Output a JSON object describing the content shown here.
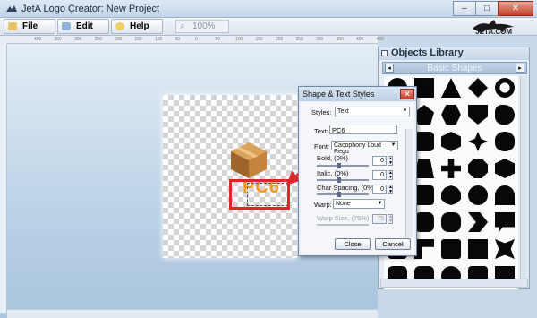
{
  "window": {
    "title": "JetA Logo Creator: New Project",
    "buttons": {
      "minimize": "–",
      "maximize": "□",
      "close": "✕"
    }
  },
  "toolbar": {
    "file_label": "File",
    "edit_label": "Edit",
    "help_label": "Help",
    "zoom_value": "100%"
  },
  "brand": {
    "logo_text": "JETA.COM"
  },
  "ruler": {
    "ticks": [
      "400",
      "350",
      "300",
      "250",
      "200",
      "150",
      "100",
      "50",
      "0",
      "50",
      "100",
      "150",
      "200",
      "250",
      "300",
      "350",
      "400",
      "450"
    ]
  },
  "canvas": {
    "logo_text": "PC6"
  },
  "library": {
    "title": "Objects Library",
    "category": "Basic Shapes",
    "prev_icon": "◂",
    "next_icon": "▸"
  },
  "dialog": {
    "title": "Shape & Text Styles",
    "close_icon": "✕",
    "styles_label": "Styles:",
    "styles_value": "Text",
    "text_label": "Text:",
    "text_value": "PC6",
    "font_label": "Font:",
    "font_value": "Cacophony Loud Regu",
    "bold_label": "Bold, (0%)",
    "bold_value": "0",
    "italic_label": "Italic, (0%)",
    "italic_value": "0",
    "char_spacing_label": "Char Spacing, (0%",
    "char_spacing_value": "0",
    "warp_label": "Warp:",
    "warp_value": "None",
    "warp_size_label": "Warp Size, (75%)",
    "warp_size_value": "75",
    "close_button": "Close",
    "cancel_button": "Cancel"
  },
  "colors": {
    "accent_red": "#e0242c",
    "logo_orange": "#f29a1a"
  }
}
